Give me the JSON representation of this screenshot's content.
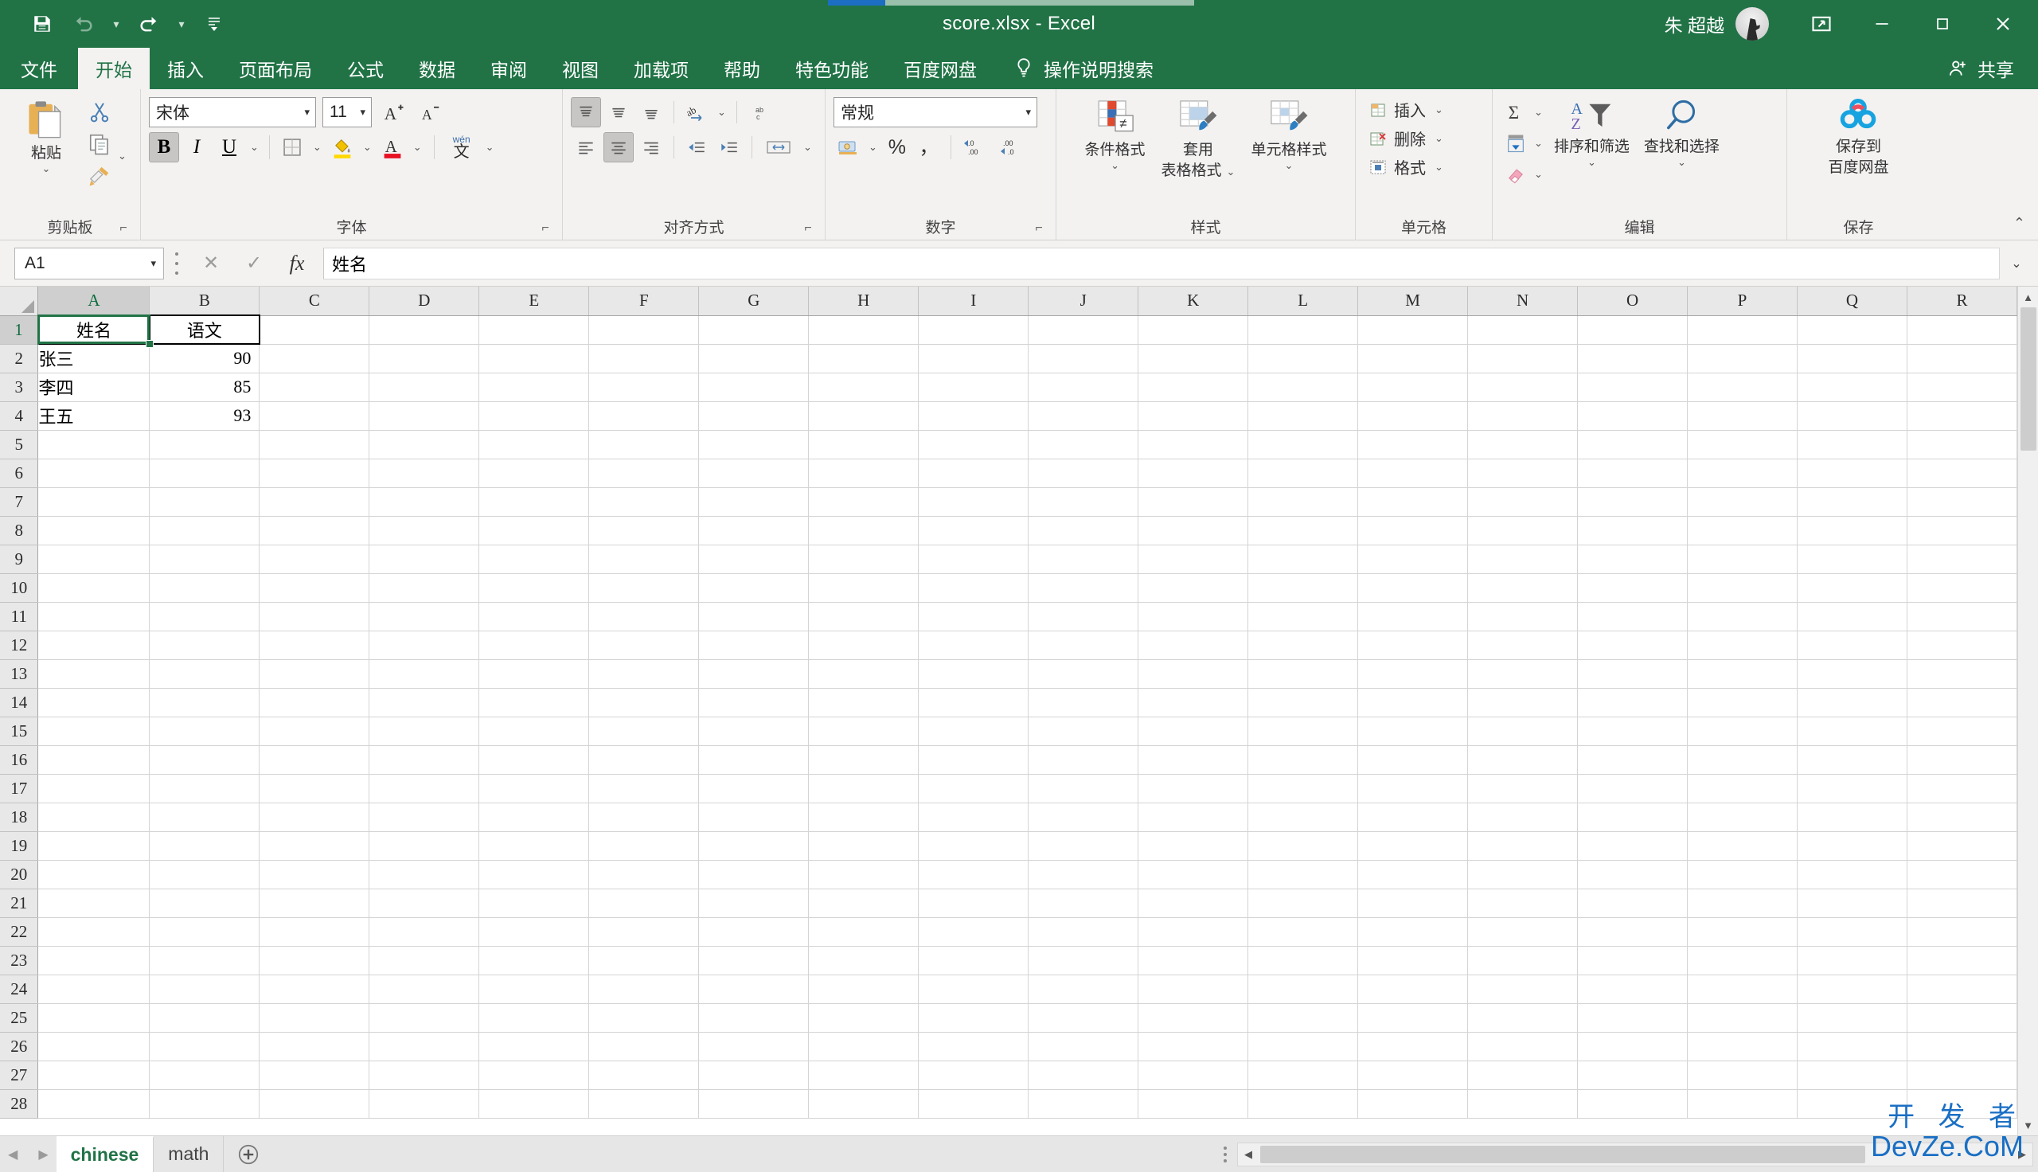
{
  "titlebar": {
    "quick_access": [
      {
        "name": "save",
        "label": "保存",
        "icon": "save-icon",
        "enabled": true
      },
      {
        "name": "undo",
        "label": "撤消",
        "icon": "undo-icon",
        "enabled": false
      },
      {
        "name": "redo",
        "label": "恢复",
        "icon": "redo-icon",
        "enabled": true
      },
      {
        "name": "customize",
        "label": "自定义快速访问工具栏",
        "icon": "chevron-down-icon",
        "enabled": true
      }
    ],
    "document_title": "score.xlsx  -  Excel",
    "user_name": "朱 超越",
    "window_buttons": {
      "ribbon_display": "功能区显示选项",
      "minimize": "最小化",
      "maximize": "最大化",
      "close": "关闭"
    }
  },
  "tabs": [
    {
      "label": "文件",
      "active": false
    },
    {
      "label": "开始",
      "active": true
    },
    {
      "label": "插入",
      "active": false
    },
    {
      "label": "页面布局",
      "active": false
    },
    {
      "label": "公式",
      "active": false
    },
    {
      "label": "数据",
      "active": false
    },
    {
      "label": "审阅",
      "active": false
    },
    {
      "label": "视图",
      "active": false
    },
    {
      "label": "加载项",
      "active": false
    },
    {
      "label": "帮助",
      "active": false
    },
    {
      "label": "特色功能",
      "active": false
    },
    {
      "label": "百度网盘",
      "active": false
    }
  ],
  "tellme": {
    "label": "操作说明搜索",
    "icon": "lightbulb-icon"
  },
  "share": {
    "label": "共享",
    "icon": "share-person-icon"
  },
  "ribbon": {
    "clipboard": {
      "group_label": "剪贴板",
      "paste_label": "粘贴",
      "cut_label": "剪切",
      "copy_label": "复制",
      "format_painter_label": "格式刷"
    },
    "font": {
      "group_label": "字体",
      "font_name": "宋体",
      "font_size": "11",
      "grow_font": "增大字号",
      "shrink_font": "减小字号",
      "bold": "B",
      "italic": "I",
      "underline": "U",
      "borders": "边框",
      "fill_color": "填充颜色",
      "font_color": "字体颜色",
      "phonetic": "显示或隐藏拼音字段",
      "phonetic_top": "wén",
      "phonetic_bottom": "文",
      "bold_active": true
    },
    "alignment": {
      "group_label": "对齐方式",
      "align_top": "顶端对齐",
      "align_middle": "垂直居中",
      "align_bottom": "底端对齐",
      "orientation": "方向",
      "align_left": "左对齐",
      "align_center": "居中",
      "align_right": "右对齐",
      "decrease_indent": "减少缩进量",
      "increase_indent": "增加缩进量",
      "wrap_text": "自动换行",
      "merge_cells": "合并后居中"
    },
    "number": {
      "group_label": "数字",
      "format": "常规",
      "accounting": "会计数字格式",
      "percent": "%",
      "comma": "，",
      "increase_decimal": "增加小数位数",
      "decrease_decimal": "减少小数位数"
    },
    "styles": {
      "group_label": "样式",
      "conditional_formatting": "条件格式",
      "format_as_table_l1": "套用",
      "format_as_table_l2": "表格格式",
      "cell_styles": "单元格样式"
    },
    "cells": {
      "group_label": "单元格",
      "insert": "插入",
      "delete": "删除",
      "format": "格式"
    },
    "editing": {
      "group_label": "编辑",
      "autosum": "自动求和",
      "fill": "填充",
      "clear": "清除",
      "sort_filter": "排序和筛选",
      "find_select": "查找和选择"
    },
    "save_group": {
      "group_label": "保存",
      "button_l1": "保存到",
      "button_l2": "百度网盘"
    },
    "collapse_ribbon": "折叠功能区"
  },
  "formula_bar": {
    "name_box": "A1",
    "cancel": "取消",
    "enter": "输入",
    "insert_function": "fx",
    "value": "姓名",
    "expand": "展开编辑栏"
  },
  "sheet": {
    "columns": [
      "A",
      "B",
      "C",
      "D",
      "E",
      "F",
      "G",
      "H",
      "I",
      "J",
      "K",
      "L",
      "M",
      "N",
      "O",
      "P",
      "Q",
      "R"
    ],
    "selected_column": "A",
    "selected_row": 1,
    "rows": [
      1,
      2,
      3,
      4,
      5,
      6,
      7,
      8,
      9,
      10,
      11,
      12,
      13,
      14,
      15,
      16,
      17,
      18,
      19,
      20,
      21,
      22,
      23,
      24,
      25,
      26,
      27,
      28
    ],
    "data": [
      {
        "row": 1,
        "A": "姓名",
        "B": "语文",
        "A_align": "center",
        "B_align": "center",
        "boxed": true
      },
      {
        "row": 2,
        "A": "张三",
        "B": "90",
        "A_align": "left",
        "B_align": "right",
        "boxed": false
      },
      {
        "row": 3,
        "A": "李四",
        "B": "85",
        "A_align": "left",
        "B_align": "right",
        "boxed": false
      },
      {
        "row": 4,
        "A": "王五",
        "B": "93",
        "A_align": "left",
        "B_align": "right",
        "boxed": false
      }
    ],
    "active_cell": "A1"
  },
  "sheet_tabs": {
    "prev_label": "上一张工作表",
    "next_label": "下一张工作表",
    "tabs": [
      {
        "label": "chinese",
        "active": true
      },
      {
        "label": "math",
        "active": false
      }
    ],
    "add_label": "新工作表"
  },
  "watermark": {
    "line1": "开 发 者",
    "line2": "DevZe.CoM"
  },
  "colors": {
    "excel_green": "#217346",
    "ribbon_bg": "#f3f2f1",
    "selection_green": "#217346",
    "watermark_blue": "#1a6fc4",
    "font_color_red": "#e81123"
  }
}
